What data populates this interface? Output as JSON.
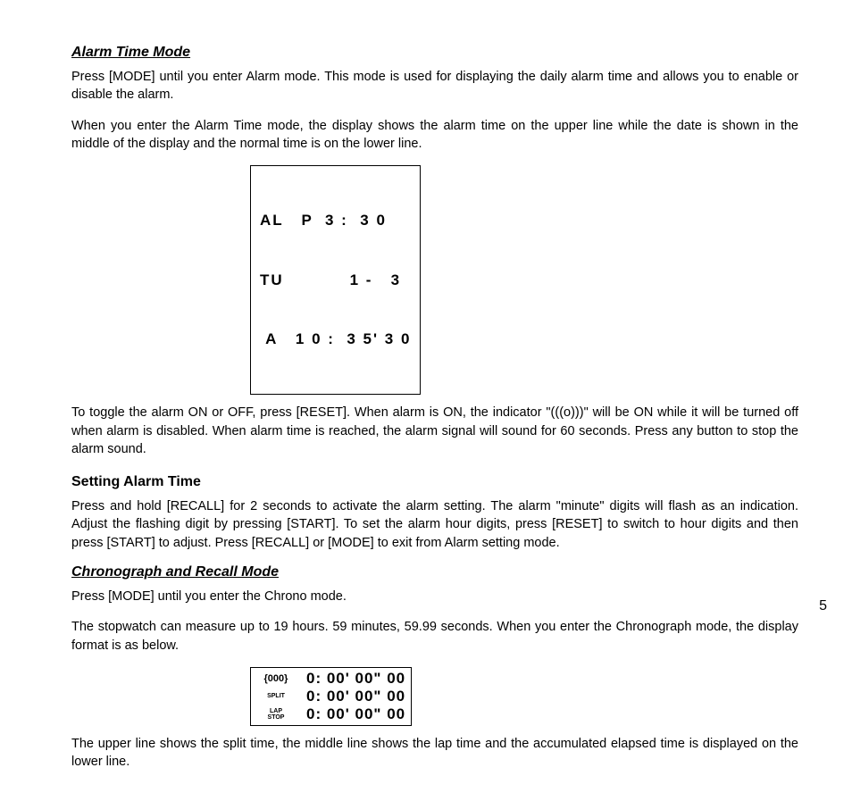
{
  "alarm_section": {
    "title": "Alarm Time Mode",
    "p1": "Press [MODE] until you enter Alarm mode.  This mode is used for displaying the daily alarm time and allows you to enable or disable the alarm.",
    "p2": "When you enter the Alarm Time mode, the display shows the alarm time on the upper line while the date is shown in the middle of the display and the normal time is on the lower line.",
    "display": {
      "line1": "AL   P  3 :  3 0",
      "line2": "TU           1 -   3",
      "line3": " A   1 0 :  3 5' 3 0"
    },
    "p3": "To toggle the alarm ON or OFF, press [RESET].  When alarm is ON, the indicator \"(((o)))\" will be ON while it will be turned off when alarm is disabled.  When alarm time is reached, the alarm signal will sound for 60 seconds. Press any button to stop the alarm sound."
  },
  "setting_section": {
    "title": "Setting  Alarm  Time",
    "p1": "Press and hold [RECALL] for 2 seconds to activate the alarm setting. The alarm \"minute\" digits will flash as an indication. Adjust the flashing digit by pressing [START].  To set the alarm hour digits, press [RESET] to switch to hour digits and then press [START] to adjust. Press [RECALL] or [MODE] to exit from Alarm setting mode."
  },
  "chrono_section": {
    "title": "Chronograph and Recall Mode",
    "p1": "Press [MODE] until you enter the Chrono mode.",
    "p2": "The stopwatch can measure up to 19 hours. 59 minutes, 59.99 seconds. When you enter the Chronograph mode, the display format is as below.",
    "display": {
      "label1": "{000}",
      "label2": "SPLIT",
      "label3a": "LAP",
      "label3b": "STOP",
      "val1": "0: 00' 00\" 00",
      "val2": "0: 00' 00\" 00",
      "val3": "0: 00' 00\" 00"
    },
    "p3": "The upper line shows the split time, the middle line shows the lap time and the accumulated elapsed time is displayed on the lower line."
  },
  "page_number": "5"
}
